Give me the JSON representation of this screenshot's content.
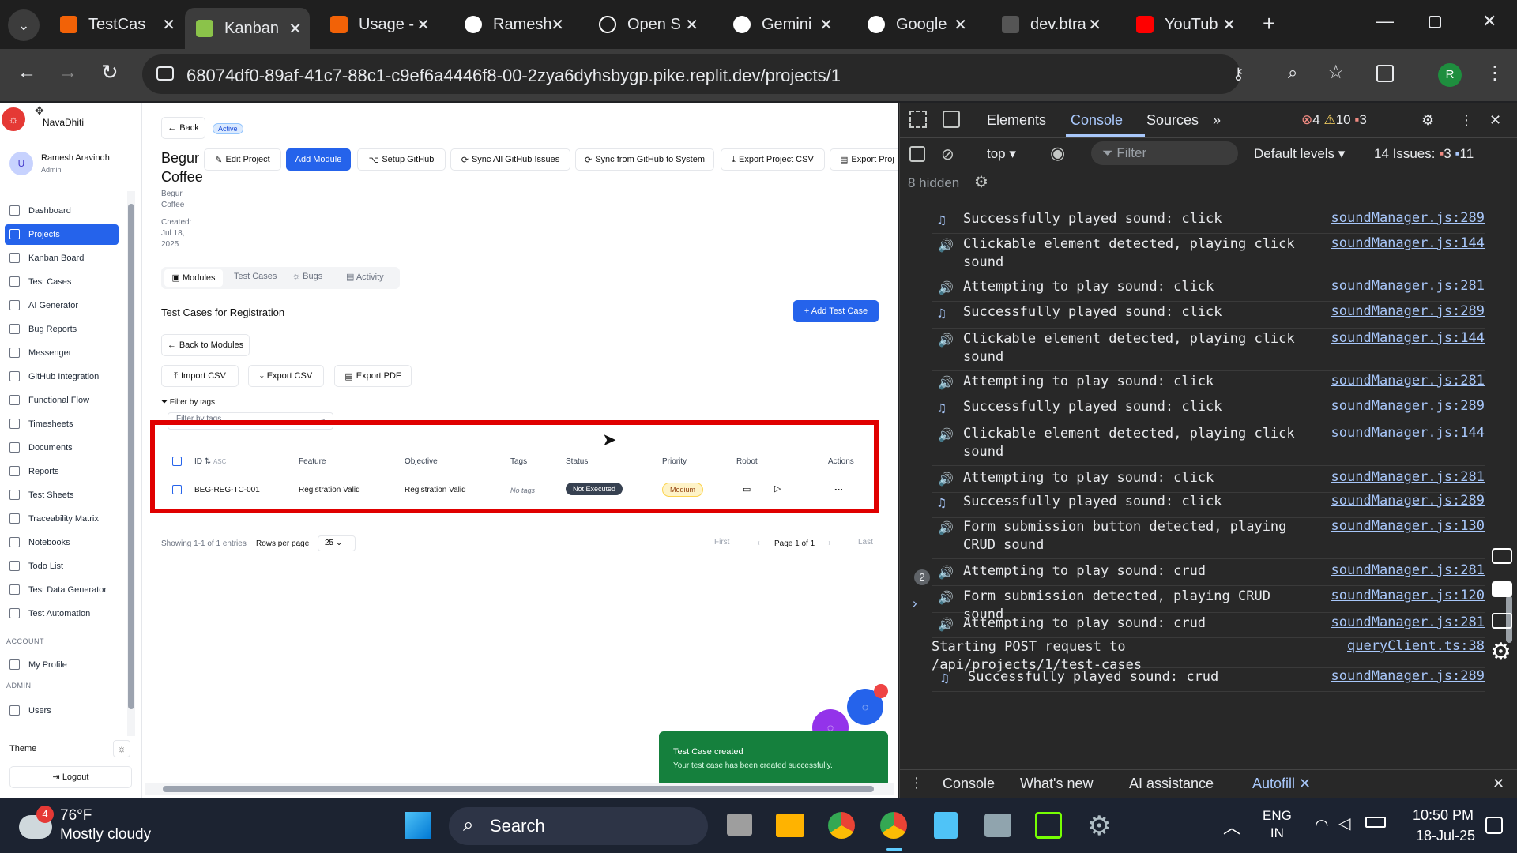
{
  "browser": {
    "tabs": [
      {
        "label": "TestCas",
        "color": "#f26207"
      },
      {
        "label": "Kanban",
        "color": "#8bc34a"
      },
      {
        "label": "Usage -",
        "color": "#f26207"
      },
      {
        "label": "Ramesh",
        "color": "#ffffff"
      },
      {
        "label": "Open S",
        "color": "#ffffff"
      },
      {
        "label": "Gemini",
        "color": "#4285f4"
      },
      {
        "label": "Google",
        "color": "#4285f4"
      },
      {
        "label": "dev.btra",
        "color": "#ffffff"
      },
      {
        "label": "YouTub",
        "color": "#ff0000"
      }
    ],
    "url": "68074df0-89af-41c7-88c1-c9ef6a4446f8-00-2zya6dyhsbygp.pike.replit.dev/projects/1",
    "profile_initial": "R"
  },
  "app": {
    "brand": "NavaDhiti",
    "user": {
      "initial": "U",
      "name": "Ramesh Aravindh",
      "role": "Admin"
    },
    "nav": [
      "Dashboard",
      "Projects",
      "Kanban Board",
      "Test Cases",
      "AI Generator",
      "Bug Reports",
      "Messenger",
      "GitHub Integration",
      "Functional Flow",
      "Timesheets",
      "Documents",
      "Reports",
      "Test Sheets",
      "Traceability Matrix",
      "Notebooks",
      "Todo List",
      "Test Data Generator",
      "Test Automation"
    ],
    "account_label": "ACCOUNT",
    "my_profile": "My Profile",
    "admin_label": "ADMIN",
    "users": "Users",
    "theme_label": "Theme",
    "logout": "Logout",
    "back": "Back",
    "status_badge": "Active",
    "project_title_1": "Begur",
    "project_title_2": "Coffee",
    "project_sub_1": "Begur",
    "project_sub_2": "Coffee",
    "created_label": "Created:",
    "created_1": "Jul 18,",
    "created_2": "2025",
    "toolbar": {
      "edit": "Edit Project",
      "add_module": "Add Module",
      "setup_github": "Setup GitHub",
      "sync_all": "Sync All GitHub Issues",
      "sync_from": "Sync from GitHub to System",
      "export_csv": "Export Project CSV",
      "export_proj": "Export Proj"
    },
    "tabs": [
      "Modules",
      "Test Cases",
      "Bugs",
      "Activity"
    ],
    "section_title": "Test Cases for Registration",
    "add_test_case": "+ Add Test Case",
    "back_modules": "Back to Modules",
    "import_csv": "Import CSV",
    "export_csv2": "Export CSV",
    "export_pdf": "Export PDF",
    "filter_label": "Filter by tags",
    "filter_placeholder": "Filter by tags",
    "table": {
      "headers": {
        "id": "ID",
        "asc": "ASC",
        "feature": "Feature",
        "objective": "Objective",
        "tags": "Tags",
        "status": "Status",
        "priority": "Priority",
        "robot": "Robot",
        "actions": "Actions"
      },
      "row": {
        "id": "BEG-REG-TC-001",
        "feature": "Registration Valid",
        "objective": "Registration Valid",
        "tags": "No tags",
        "status": "Not Executed",
        "priority": "Medium",
        "more": "..."
      }
    },
    "pagination": {
      "showing": "Showing 1-1 of 1 entries",
      "rows_label": "Rows per page",
      "rows_value": "25",
      "first": "First",
      "page": "Page 1 of 1",
      "last": "Last"
    },
    "toast": {
      "title": "Test Case created",
      "body": "Your test case has been created successfully."
    }
  },
  "devtools": {
    "tabs": [
      "Elements",
      "Console",
      "Sources"
    ],
    "errors": "4",
    "warnings": "10",
    "issues_badge": "3",
    "context": "top",
    "filter": "Filter",
    "levels": "Default levels",
    "issues_label": "14 Issues:",
    "issues_err": "3",
    "issues_info": "11",
    "hidden": "8 hidden",
    "logs": [
      {
        "msg": "Successfully played sound: click",
        "src": "soundManager.js:289",
        "icon": "♫"
      },
      {
        "msg": "Clickable element detected, playing click sound",
        "src": "soundManager.js:144",
        "icon": "🔊"
      },
      {
        "msg": "Attempting to play sound: click",
        "src": "soundManager.js:281",
        "icon": "🔊"
      },
      {
        "msg": "Successfully played sound: click",
        "src": "soundManager.js:289",
        "icon": "♫"
      },
      {
        "msg": "Clickable element detected, playing click sound",
        "src": "soundManager.js:144",
        "icon": "🔊"
      },
      {
        "msg": "Attempting to play sound: click",
        "src": "soundManager.js:281",
        "icon": "🔊"
      },
      {
        "msg": "Successfully played sound: click",
        "src": "soundManager.js:289",
        "icon": "♫"
      },
      {
        "msg": "Clickable element detected, playing click sound",
        "src": "soundManager.js:144",
        "icon": "🔊"
      },
      {
        "msg": "Attempting to play sound: click",
        "src": "soundManager.js:281",
        "icon": "🔊"
      },
      {
        "msg": "Successfully played sound: click",
        "src": "soundManager.js:289",
        "icon": "♫"
      },
      {
        "msg": "Form submission button detected, playing CRUD sound",
        "src": "soundManager.js:130",
        "icon": "🔊"
      },
      {
        "msg": "Attempting to play sound: crud",
        "src": "soundManager.js:281",
        "icon": "🔊"
      },
      {
        "msg": "Form submission detected, playing CRUD sound",
        "src": "soundManager.js:120",
        "icon": "🔊"
      },
      {
        "msg": "Attempting to play sound: crud",
        "src": "soundManager.js:281",
        "icon": "🔊"
      },
      {
        "msg": "Starting POST request to /api/projects/1/test-cases",
        "src": "queryClient.ts:38",
        "icon": ""
      },
      {
        "msg": "Successfully played sound: crud",
        "src": "soundManager.js:289",
        "icon": "♫"
      }
    ],
    "repeat_count": "2",
    "drawer": [
      "Console",
      "What's new",
      "AI assistance",
      "Autofill"
    ]
  },
  "taskbar": {
    "temp": "76°F",
    "weather": "Mostly cloudy",
    "weather_badge": "4",
    "search": "Search",
    "lang1": "ENG",
    "lang2": "IN",
    "time": "10:50 PM",
    "date": "18-Jul-25"
  }
}
